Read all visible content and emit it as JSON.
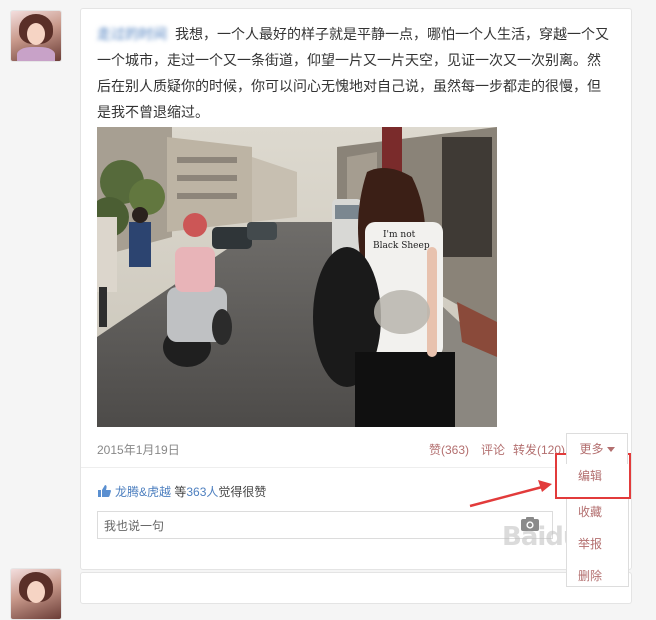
{
  "post": {
    "author": "走过的时间",
    "text": "我想，一个人最好的样子就是平静一点，哪怕一个人生活，穿越一个又一个城市，走过一个又一条街道，仰望一片又一片天空，见证一次又一次别离。然后在别人质疑你的时候，你可以问心无愧地对自己说，虽然每一步都走的很慢，但是我不曾退缩过。",
    "photo_shirt_text": "I'm not\nBlack Sheep",
    "date": "2015年1月19日",
    "actions": {
      "like": "赞(363)",
      "comment": "评论",
      "repost": "转发(120)",
      "more": "更多"
    },
    "likes": {
      "user1": "龙腾&虎越",
      "mid": "等",
      "count": "363人",
      "suffix": "觉得很赞"
    },
    "comment_placeholder": "我也说一句"
  },
  "dropdown": {
    "items": [
      "编辑",
      "收藏",
      "举报",
      "删除"
    ]
  },
  "watermark": "Baidu",
  "colors": {
    "link": "#4d7fbf",
    "action": "#b36f6f",
    "highlight": "#e23b3b"
  }
}
